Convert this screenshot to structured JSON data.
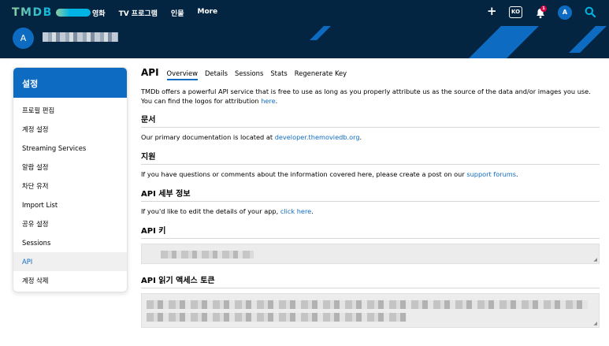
{
  "brand": {
    "logo_text": "TMDB"
  },
  "nav": {
    "links": [
      "영화",
      "TV 프로그램",
      "인물",
      "More"
    ],
    "language": "KO",
    "notification_count": "1",
    "avatar_letter": "A"
  },
  "profile": {
    "avatar_letter": "A"
  },
  "sidebar": {
    "title": "설정",
    "items": [
      "프로필 편집",
      "계정 설정",
      "Streaming Services",
      "알람 설정",
      "차단 유저",
      "Import List",
      "공유 설정",
      "Sessions",
      "API",
      "계정 삭제"
    ],
    "active_index": 8
  },
  "main": {
    "title": "API",
    "tabs": [
      "Overview",
      "Details",
      "Sessions",
      "Stats",
      "Regenerate Key"
    ],
    "intro_text": "TMDb offers a powerful API service that is free to use as long as you properly attribute us as the source of the data and/or images you use. You can find the logos for attribution ",
    "intro_link": "here",
    "intro_end": ".",
    "docs": {
      "title": "문서",
      "text": "Our primary documentation is located at ",
      "link": "developer.themoviedb.org",
      "end": "."
    },
    "support": {
      "title": "지원",
      "text": "If you'd like to edit the details of your app, ",
      "text_full": "If you have questions or comments about the information covered here, please create a post on our ",
      "link": "support forums",
      "end": "."
    },
    "details": {
      "title": "API 세부 정보",
      "text": "If you'd like to edit the details of your app, ",
      "link": "click here",
      "end": "."
    },
    "api_key": {
      "title": "API 키"
    },
    "read_token": {
      "title": "API 읽기 액세스 토큰"
    }
  },
  "colors": {
    "navy": "#032541",
    "accent": "#0d6cc2",
    "notification": "#d40242"
  }
}
